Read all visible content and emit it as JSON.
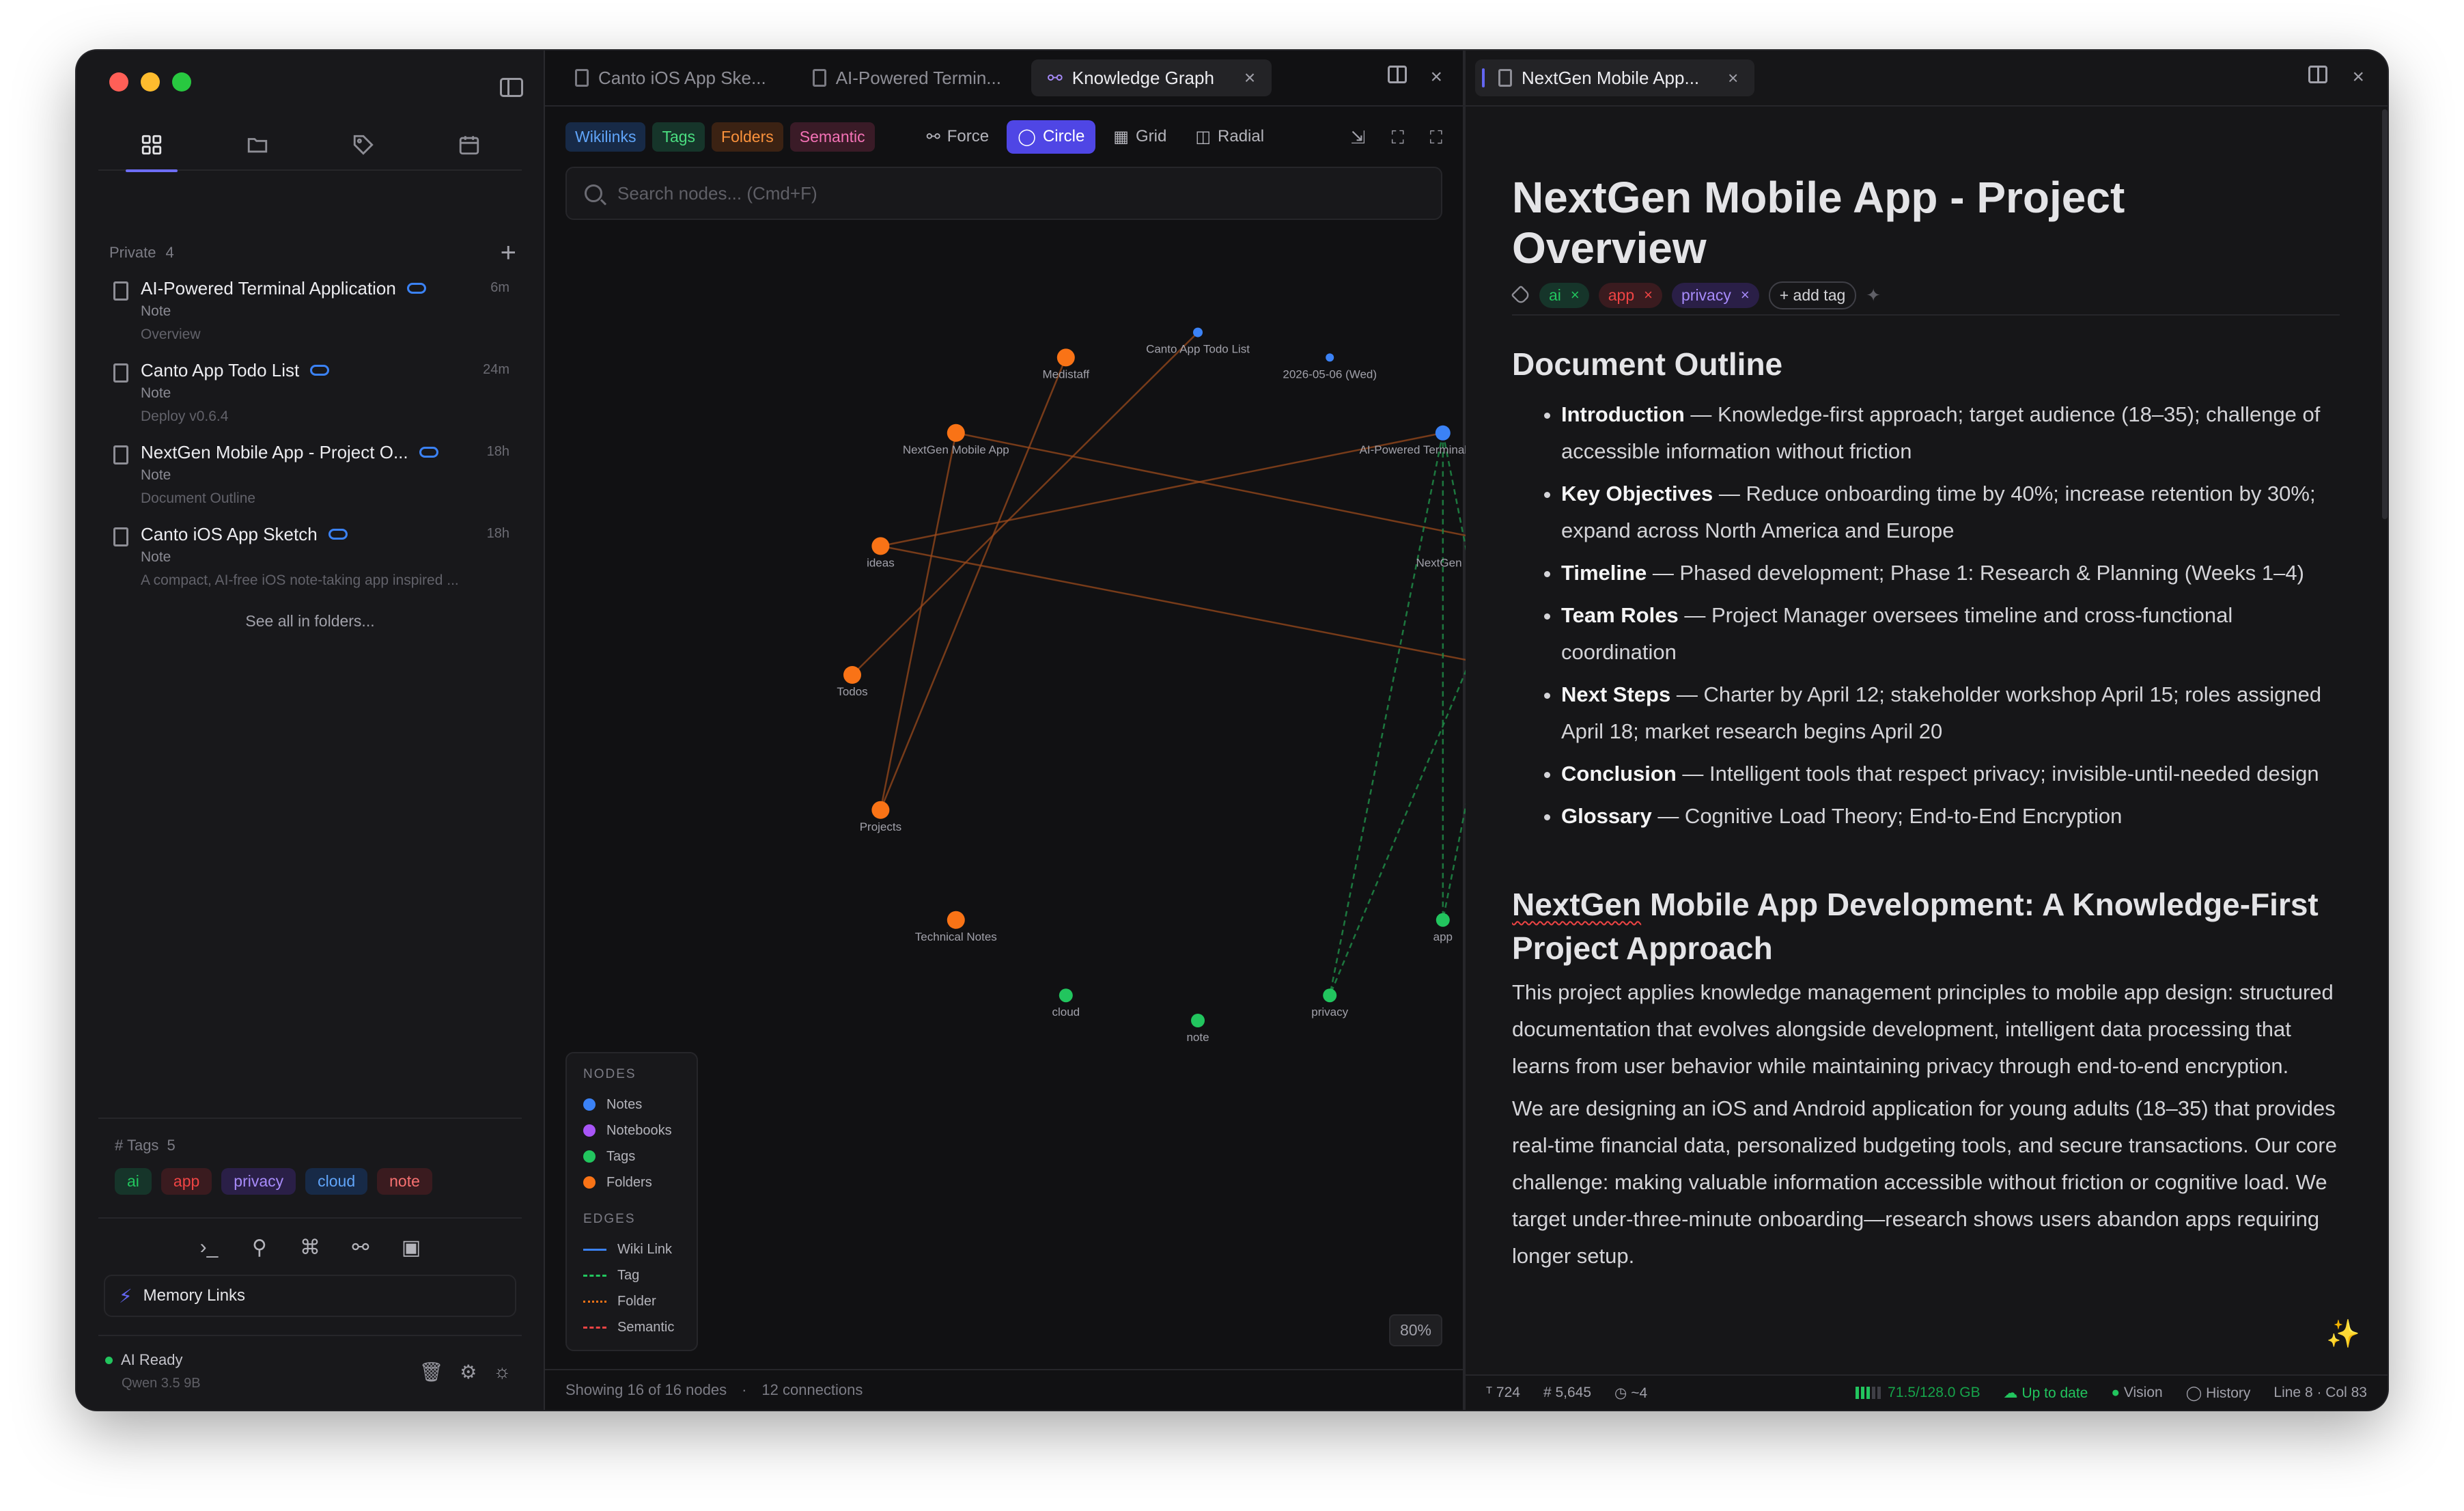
{
  "sidebar": {
    "section_label": "Private",
    "section_count": "4",
    "notes": [
      {
        "title": "AI-Powered Terminal Application",
        "time": "6m",
        "type": "Note",
        "subtitle": "Overview"
      },
      {
        "title": "Canto App Todo List",
        "time": "24m",
        "type": "Note",
        "subtitle": "Deploy v0.6.4"
      },
      {
        "title": "NextGen Mobile App - Project O...",
        "time": "18h",
        "type": "Note",
        "subtitle": "Document Outline"
      },
      {
        "title": "Canto iOS App Sketch",
        "time": "18h",
        "type": "Note",
        "subtitle": "A compact, AI-free iOS note-taking app inspired ..."
      }
    ],
    "see_all": "See all in folders...",
    "tags_label": "Tags",
    "tags_count": "5",
    "tags": [
      "ai",
      "app",
      "privacy",
      "cloud",
      "note"
    ],
    "memory_links": "Memory Links",
    "ai_status": "AI Ready",
    "model": "Qwen 3.5 9B"
  },
  "center": {
    "tabs": [
      {
        "label": "Canto iOS App Ske..."
      },
      {
        "label": "AI-Powered Termin..."
      },
      {
        "label": "Knowledge Graph"
      }
    ],
    "filters": [
      "Wikilinks",
      "Tags",
      "Folders",
      "Semantic"
    ],
    "layouts": [
      "Force",
      "Circle",
      "Grid",
      "Radial"
    ],
    "active_layout": "Circle",
    "search_placeholder": "Search nodes... (Cmd+F)",
    "legend": {
      "nodes_title": "NODES",
      "nodes": [
        {
          "label": "Notes",
          "color": "#3b82f6"
        },
        {
          "label": "Notebooks",
          "color": "#a855f7"
        },
        {
          "label": "Tags",
          "color": "#22c55e"
        },
        {
          "label": "Folders",
          "color": "#f97316"
        }
      ],
      "edges_title": "EDGES",
      "edges": [
        {
          "label": "Wiki Link",
          "color": "#3b82f6",
          "style": "solid"
        },
        {
          "label": "Tag",
          "color": "#22c55e",
          "style": "dashed"
        },
        {
          "label": "Folder",
          "color": "#f97316",
          "style": "dotted"
        },
        {
          "label": "Semantic",
          "color": "#ef4444",
          "style": "dashed"
        }
      ]
    },
    "zoom": "80%",
    "footer_nodes": "Showing 16 of 16 nodes",
    "footer_sep": "·",
    "footer_connections": "12 connections"
  },
  "graph": {
    "nodes": [
      {
        "id": "todo",
        "label": "Canto App Todo List",
        "kind": "note"
      },
      {
        "id": "date",
        "label": "2026-05-06 (Wed)",
        "kind": "note"
      },
      {
        "id": "term",
        "label": "AI-Powered Terminal Application",
        "kind": "note"
      },
      {
        "id": "nextgen",
        "label": "NextGen Mobile App - Project Overview",
        "kind": "note"
      },
      {
        "id": "sketch",
        "label": "Canto iOS App Sketch",
        "kind": "note"
      },
      {
        "id": "ai",
        "label": "ai",
        "kind": "tag"
      },
      {
        "id": "app",
        "label": "app",
        "kind": "tag"
      },
      {
        "id": "privacy",
        "label": "privacy",
        "kind": "tag"
      },
      {
        "id": "note",
        "label": "note",
        "kind": "tag"
      },
      {
        "id": "cloud",
        "label": "cloud",
        "kind": "tag"
      },
      {
        "id": "tech",
        "label": "Technical Notes",
        "kind": "folder"
      },
      {
        "id": "projects",
        "label": "Projects",
        "kind": "folder"
      },
      {
        "id": "todos",
        "label": "Todos",
        "kind": "folder"
      },
      {
        "id": "ideas",
        "label": "ideas",
        "kind": "folder"
      },
      {
        "id": "ngapp",
        "label": "NextGen Mobile App",
        "kind": "folder"
      },
      {
        "id": "medistaff",
        "label": "Medistaff",
        "kind": "folder"
      }
    ],
    "edges": [
      {
        "from": "medistaff",
        "to": "projects",
        "kind": "folder"
      },
      {
        "from": "ngapp",
        "to": "projects",
        "kind": "folder"
      },
      {
        "from": "todo",
        "to": "todos",
        "kind": "folder"
      },
      {
        "from": "ngapp",
        "to": "nextgen",
        "kind": "folder"
      },
      {
        "from": "ideas",
        "to": "term",
        "kind": "folder"
      },
      {
        "from": "ideas",
        "to": "sketch",
        "kind": "folder"
      },
      {
        "from": "term",
        "to": "ai",
        "kind": "tag"
      },
      {
        "from": "term",
        "to": "app",
        "kind": "tag"
      },
      {
        "from": "term",
        "to": "privacy",
        "kind": "tag"
      },
      {
        "from": "nextgen",
        "to": "ai",
        "kind": "tag"
      },
      {
        "from": "nextgen",
        "to": "app",
        "kind": "tag"
      },
      {
        "from": "nextgen",
        "to": "privacy",
        "kind": "tag"
      }
    ]
  },
  "right": {
    "tab_label": "NextGen Mobile App...",
    "doc_title": "NextGen Mobile App - Project Overview",
    "doc_tags": [
      "ai",
      "app",
      "privacy"
    ],
    "add_tag": "+ add tag",
    "outline_heading": "Document Outline",
    "outline": [
      {
        "term": "Introduction",
        "text": " — Knowledge-first approach; target audience (18–35); challenge of accessible information without friction"
      },
      {
        "term": "Key Objectives",
        "text": " — Reduce onboarding time by 40%; increase retention by 30%; expand across North America and Europe"
      },
      {
        "term": "Timeline",
        "text": " — Phased development; Phase 1: Research & Planning (Weeks 1–4)"
      },
      {
        "term": "Team Roles",
        "text": " — Project Manager oversees timeline and cross-functional coordination"
      },
      {
        "term": "Next Steps",
        "text": " — Charter by April 12; stakeholder workshop April 15; roles assigned April 18; market research begins April 20"
      },
      {
        "term": "Conclusion",
        "text": " — Intelligent tools that respect privacy; invisible-until-needed design"
      },
      {
        "term": "Glossary",
        "text": " — Cognitive Load Theory; End-to-End Encryption"
      }
    ],
    "section2_underlined": "NextGen",
    "section2_rest": " Mobile App Development: A Knowledge-First Project Approach",
    "para1": "This project applies knowledge management principles to mobile app design: structured documentation that evolves alongside development, intelligent data processing that learns from user behavior while maintaining privacy through end-to-end encryption.",
    "para2": "We are designing an iOS and Android application for young adults (18–35) that provides real-time financial data, personalized budgeting tools, and secure transactions. Our core challenge: making valuable information accessible without friction or cognitive load. We target under-three-minute onboarding—research shows users abandon apps requiring longer setup.",
    "status": {
      "words": "724",
      "chars": "5,645",
      "read_time": "~4",
      "memory": "71.5/128.0 GB",
      "sync": "Up to date",
      "vision": "Vision",
      "history": "History",
      "cursor": "Line 8 · Col 83"
    }
  },
  "colors": {
    "accent": "#4f46e5",
    "note_node": "#3b82f6",
    "tag_node": "#22c55e",
    "folder_node": "#f97316"
  }
}
